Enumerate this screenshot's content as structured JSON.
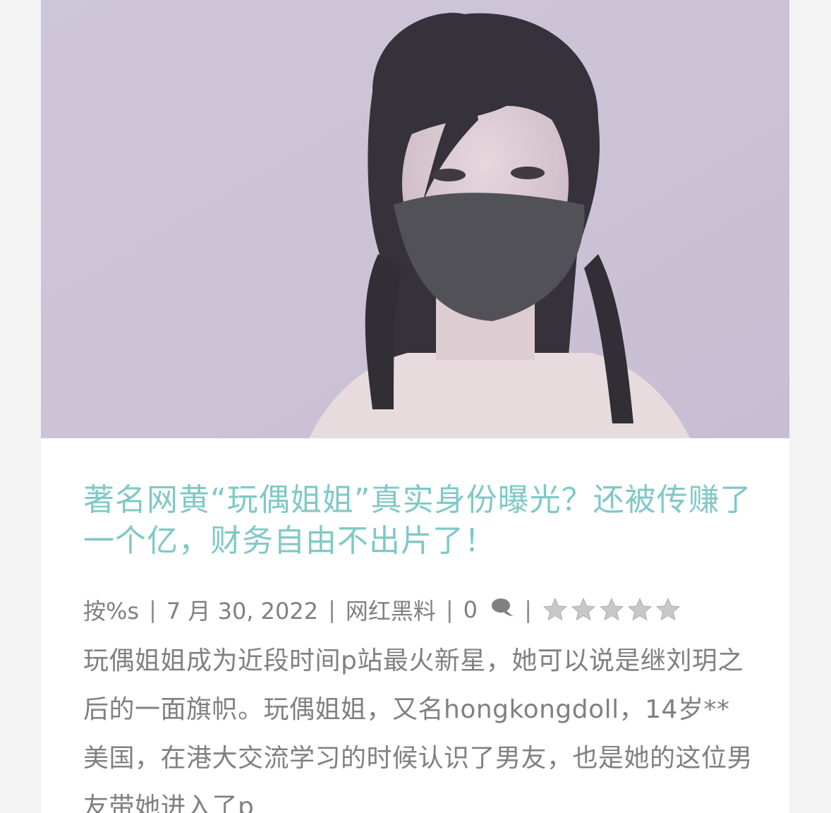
{
  "post": {
    "image_alt": "玩偶姐姐",
    "title": "著名网黄“玩偶姐姐”真实身份曝光？还被传赚了一个亿，财务自由不出片了！",
    "meta": {
      "author_prefix": "按%s",
      "separator": "|",
      "date": "7 月 30, 2022",
      "category": "网红黑料",
      "comment_count": "0",
      "comment_icon": "comment-bubble-icon",
      "rating_stars": 5,
      "rating_value": 0
    },
    "excerpt": "玩偶姐姐成为近段时间p站最火新星，她可以说是继刘玥之后的一面旗帜。玩偶姐姐，又名hongkongdoll，14岁**美国，在港大交流学习的时候认识了男友，也是她的这位男友带她进入了p"
  },
  "colors": {
    "title": "#7fc9c7",
    "meta_text": "#808080",
    "star": "#c8c8c8",
    "card_bg": "#ffffff"
  }
}
